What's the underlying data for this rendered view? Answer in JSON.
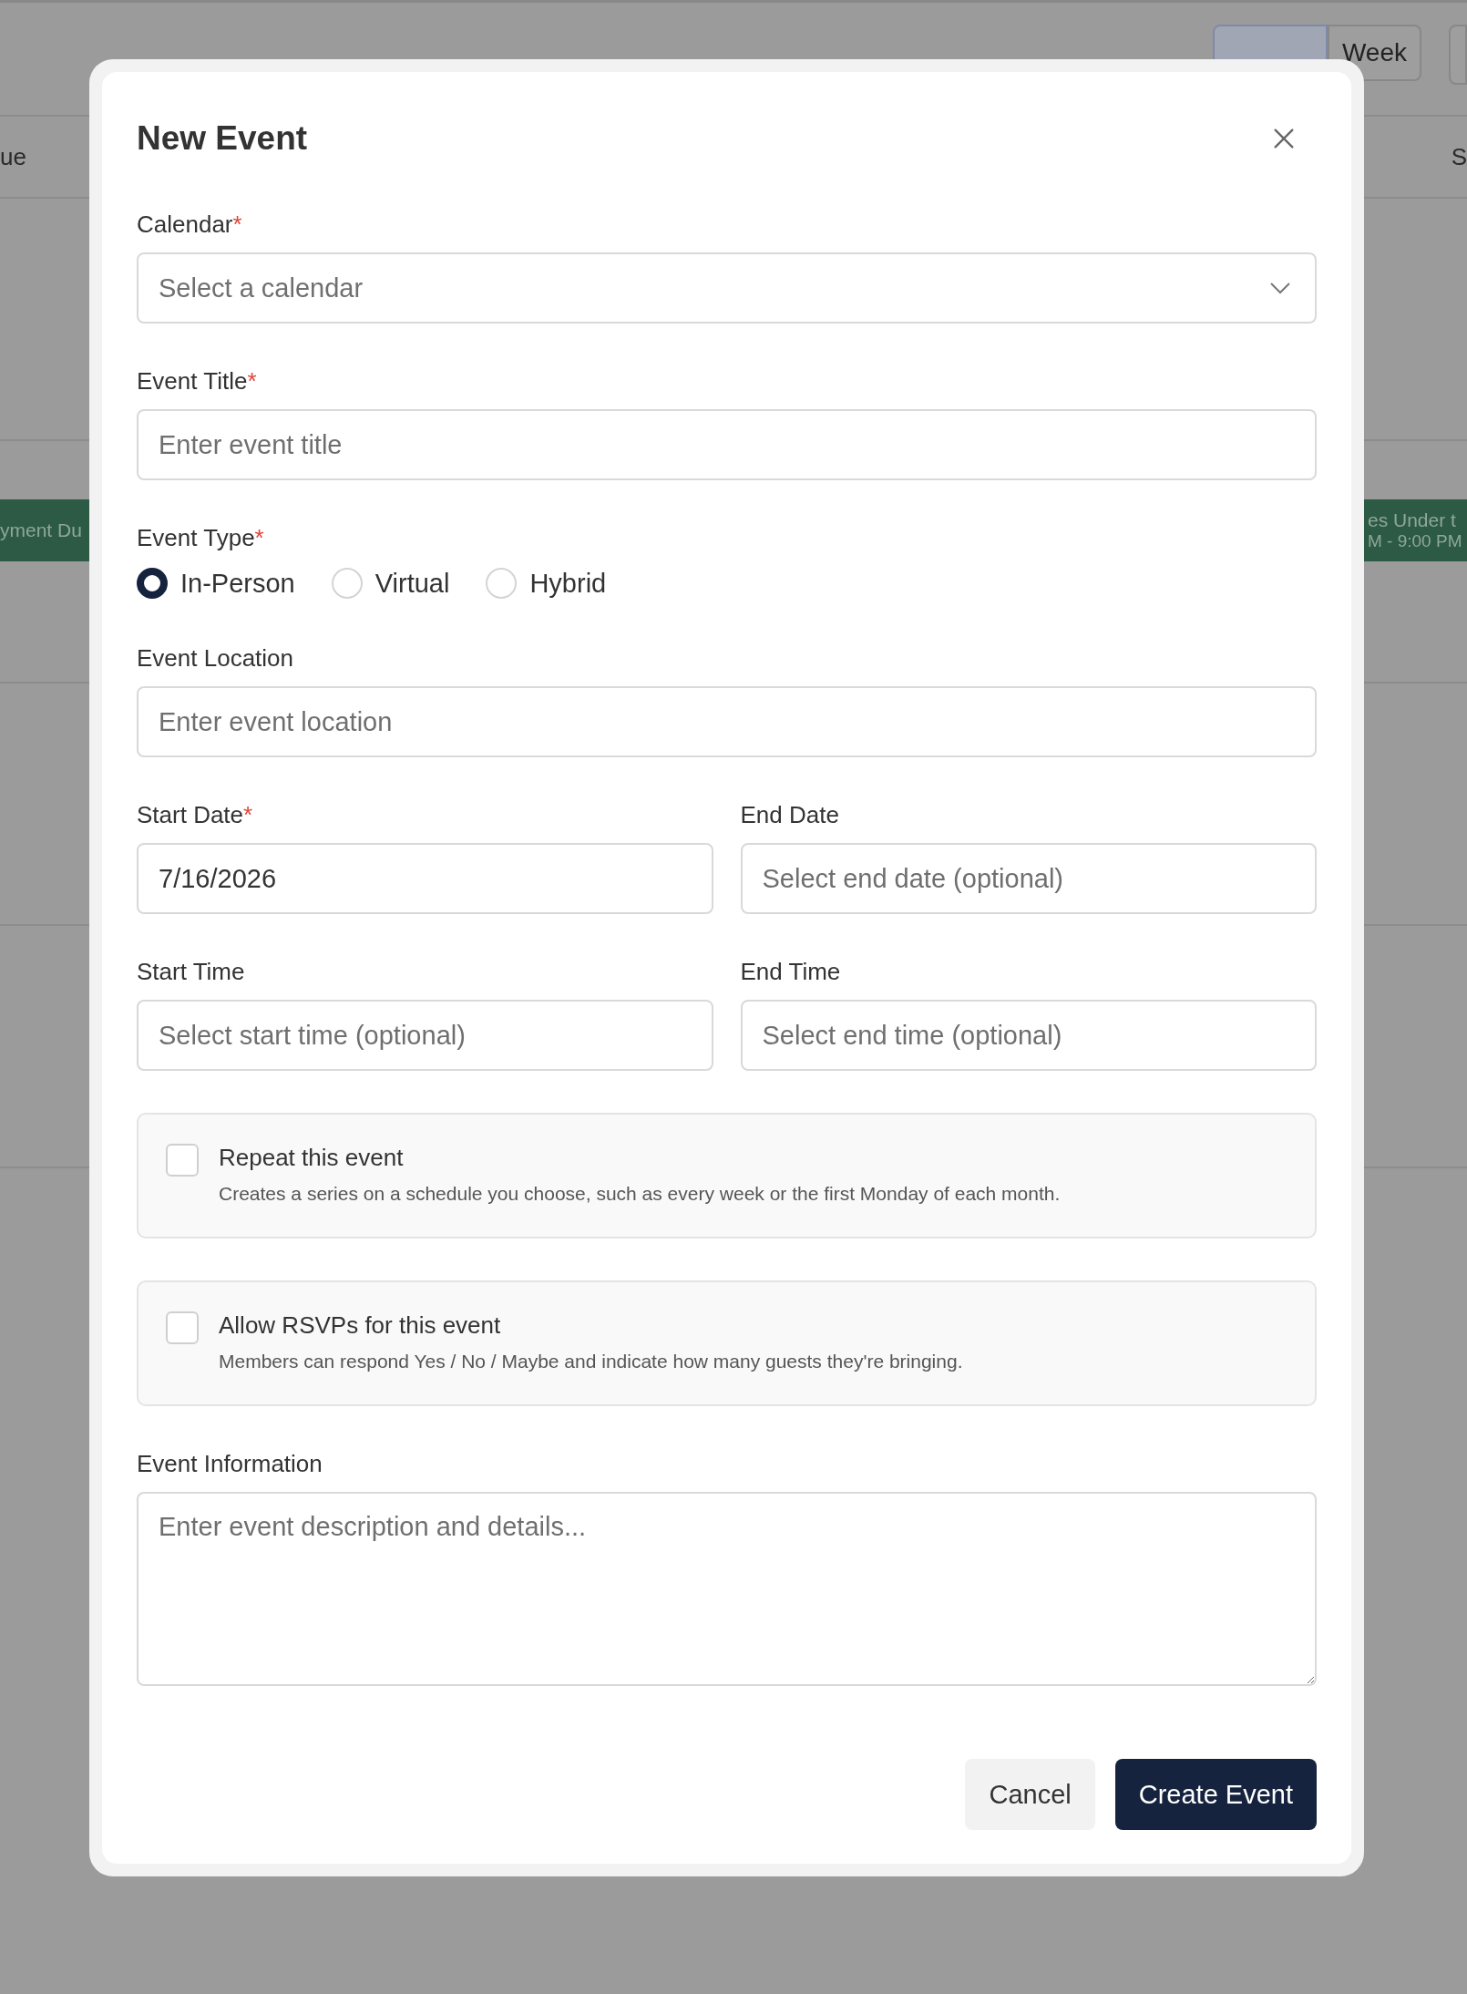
{
  "background": {
    "view_tabs": [
      {
        "selected": true
      },
      {
        "label": "Week",
        "selected": false
      }
    ],
    "day_headers": [
      "ue",
      "S"
    ],
    "events": [
      {
        "title": "yment Du"
      },
      {
        "title": "es Under t",
        "time": "M - 9:00 PM"
      }
    ]
  },
  "dialog": {
    "title": "New Event",
    "rows": [
      {
        "kind": "select",
        "label": "Calendar",
        "mark": "*",
        "placeholder": "Select a calendar"
      },
      {
        "kind": "text",
        "label": "Event Title",
        "mark": "*",
        "placeholder": "Enter event title"
      },
      {
        "kind": "radio",
        "label": "Event Type",
        "mark": "*",
        "options": [
          {
            "label": "In-Person",
            "selected": true
          },
          {
            "label": "Virtual",
            "selected": false
          },
          {
            "label": "Hybrid",
            "selected": false
          }
        ]
      },
      {
        "kind": "text",
        "label": "Event Location",
        "placeholder": "Enter event location"
      },
      {
        "kind": "pair",
        "fields": [
          {
            "label": "Start Date",
            "mark": "*",
            "value": "7/16/2026"
          },
          {
            "label": "End Date",
            "placeholder": "Select end date (optional)"
          }
        ]
      },
      {
        "kind": "pair",
        "fields": [
          {
            "label": "Start Time",
            "placeholder": "Select start time (optional)"
          },
          {
            "label": "End Time",
            "placeholder": "Select end time (optional)"
          }
        ]
      },
      {
        "kind": "checkbox",
        "label": "Repeat this event",
        "description": "Creates a series on a schedule you choose, such as every week or the first Monday of each month.",
        "checked": false
      },
      {
        "kind": "checkbox",
        "label": "Allow RSVPs for this event",
        "description": "Members can respond Yes / No / Maybe and indicate how many guests they're bringing.",
        "checked": false
      },
      {
        "kind": "textarea",
        "label": "Event Information",
        "placeholder": "Enter event description and details..."
      }
    ],
    "buttons": [
      {
        "label": "Cancel",
        "kind": "secondary"
      },
      {
        "label": "Create Event",
        "kind": "primary"
      }
    ]
  }
}
